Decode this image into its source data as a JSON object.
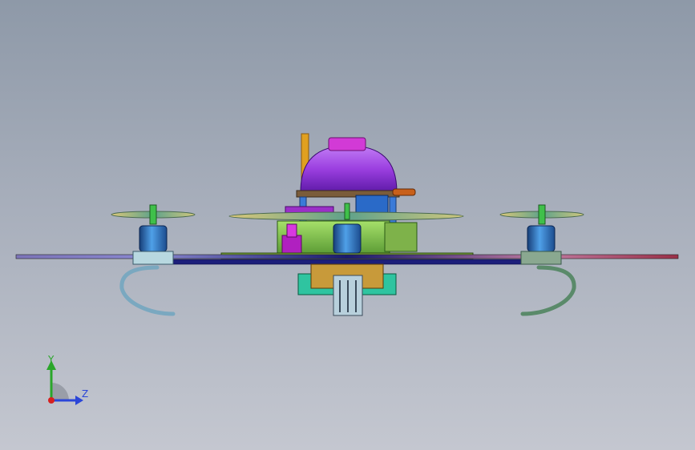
{
  "viewport": {
    "background_top": "#8e99a8",
    "background_bottom": "#c4c7d0"
  },
  "model": {
    "parts": [
      "frame-arm",
      "center-plate",
      "battery-dome",
      "motor-left",
      "motor-center",
      "motor-right",
      "propeller-left",
      "propeller-center",
      "propeller-right",
      "landing-skid-left",
      "landing-skid-right",
      "bottom-bracket",
      "antenna-rod"
    ],
    "colors": {
      "dome": "#9b3fe0",
      "dome_cap": "#d23ad6",
      "motor": "#2c6fb8",
      "arm": "#1d1f7a",
      "plate": "#7aa53a",
      "skid": "#7aa8c0",
      "bracket": "#2fc4a0",
      "antenna": "#e0a020",
      "propeller": "#d8cf7a"
    }
  },
  "triad": {
    "y_label": "Y",
    "z_label": "Z",
    "y_color": "#2aa62a",
    "z_color": "#2b46d8",
    "x_color": "#d62020"
  }
}
